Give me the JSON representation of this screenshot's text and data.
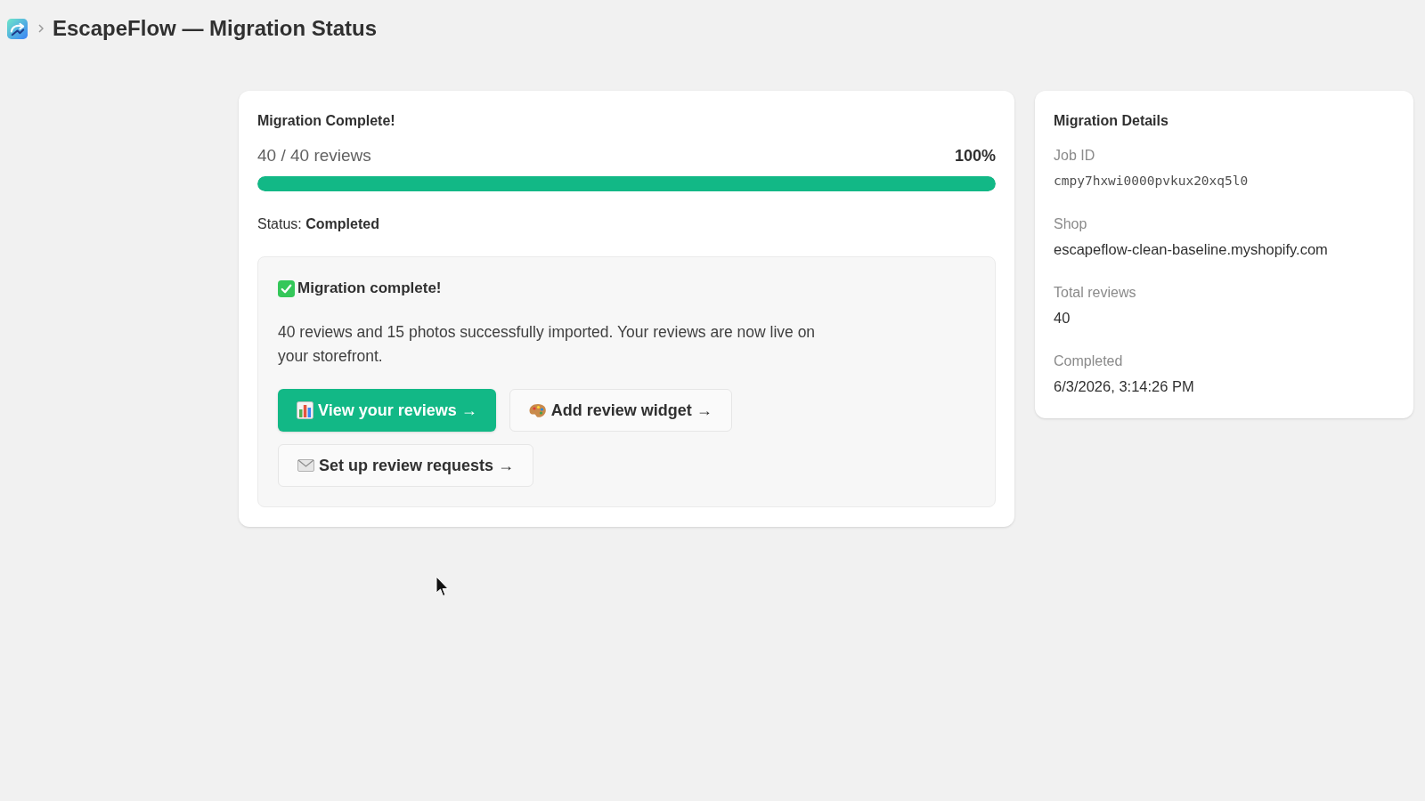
{
  "header": {
    "title": "EscapeFlow — Migration Status"
  },
  "progress_card": {
    "title": "Migration Complete!",
    "count": "40 / 40 reviews",
    "percent": "100%",
    "level": 1,
    "status": "Status: **Completed**",
    "result": {
      "heading": "Migration complete!",
      "message": "40 reviews and 15 photos successfully imported. Your reviews are now live on your storefront.",
      "buttons": [
        {
          "label": "View your reviews →",
          "kind": "primary"
        },
        {
          "label": "Add review widget →",
          "kind": "secondary"
        },
        {
          "label": "Set up review requests →",
          "kind": "secondary"
        }
      ]
    }
  },
  "details_card": {
    "title": "Migration Details",
    "items": [
      {
        "label": "Job ID",
        "value": "cmpy7hxwi0000pvkux20xq5l0",
        "kind": "mono"
      },
      {
        "label": "Shop",
        "value": "escapeflow-clean-baseline.myshopify.com",
        "kind": "text"
      },
      {
        "label": "Total reviews",
        "value": "40",
        "kind": "text"
      },
      {
        "label": "Completed",
        "value": "6/3/2026, 3:14:26 PM",
        "kind": "text"
      }
    ]
  }
}
